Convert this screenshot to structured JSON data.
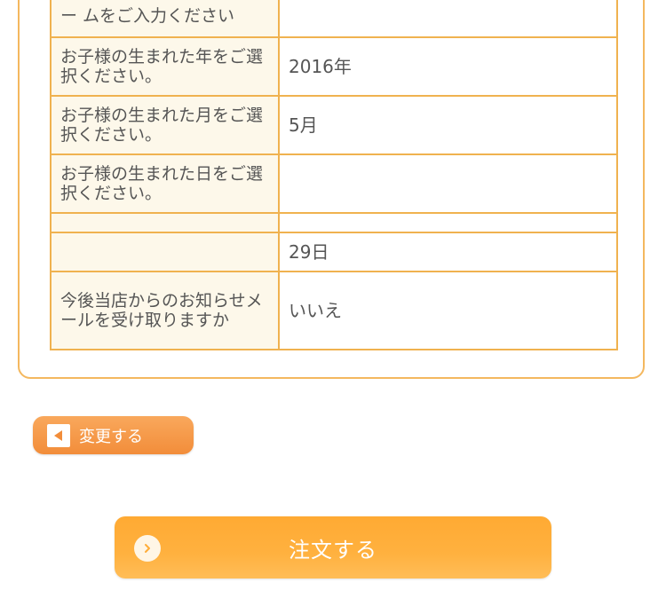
{
  "form": {
    "rows": [
      {
        "label": "ー ムをご入力ください",
        "value": ""
      },
      {
        "label": "お子様の生まれた年をご選択ください。",
        "value": "2016年"
      },
      {
        "label": "お子様の生まれた月をご選択ください。",
        "value": "5月"
      },
      {
        "label": "お子様の生まれた日をご選択ください。",
        "value": ""
      },
      {
        "label": "",
        "value": ""
      },
      {
        "label": "",
        "value": "29日"
      },
      {
        "label": "今後当店からのお知らせメールを受け取りますか",
        "value": "いいえ"
      }
    ]
  },
  "buttons": {
    "change_label": "変更する",
    "order_label": "注文する"
  },
  "colors": {
    "border": "#f0b24f",
    "label_bg": "#fdf8ea",
    "change_button": "#f28d3a",
    "order_button": "#ffad38"
  },
  "icons": {
    "change": "triangle-left-icon",
    "order": "chevron-right-circle-icon"
  }
}
